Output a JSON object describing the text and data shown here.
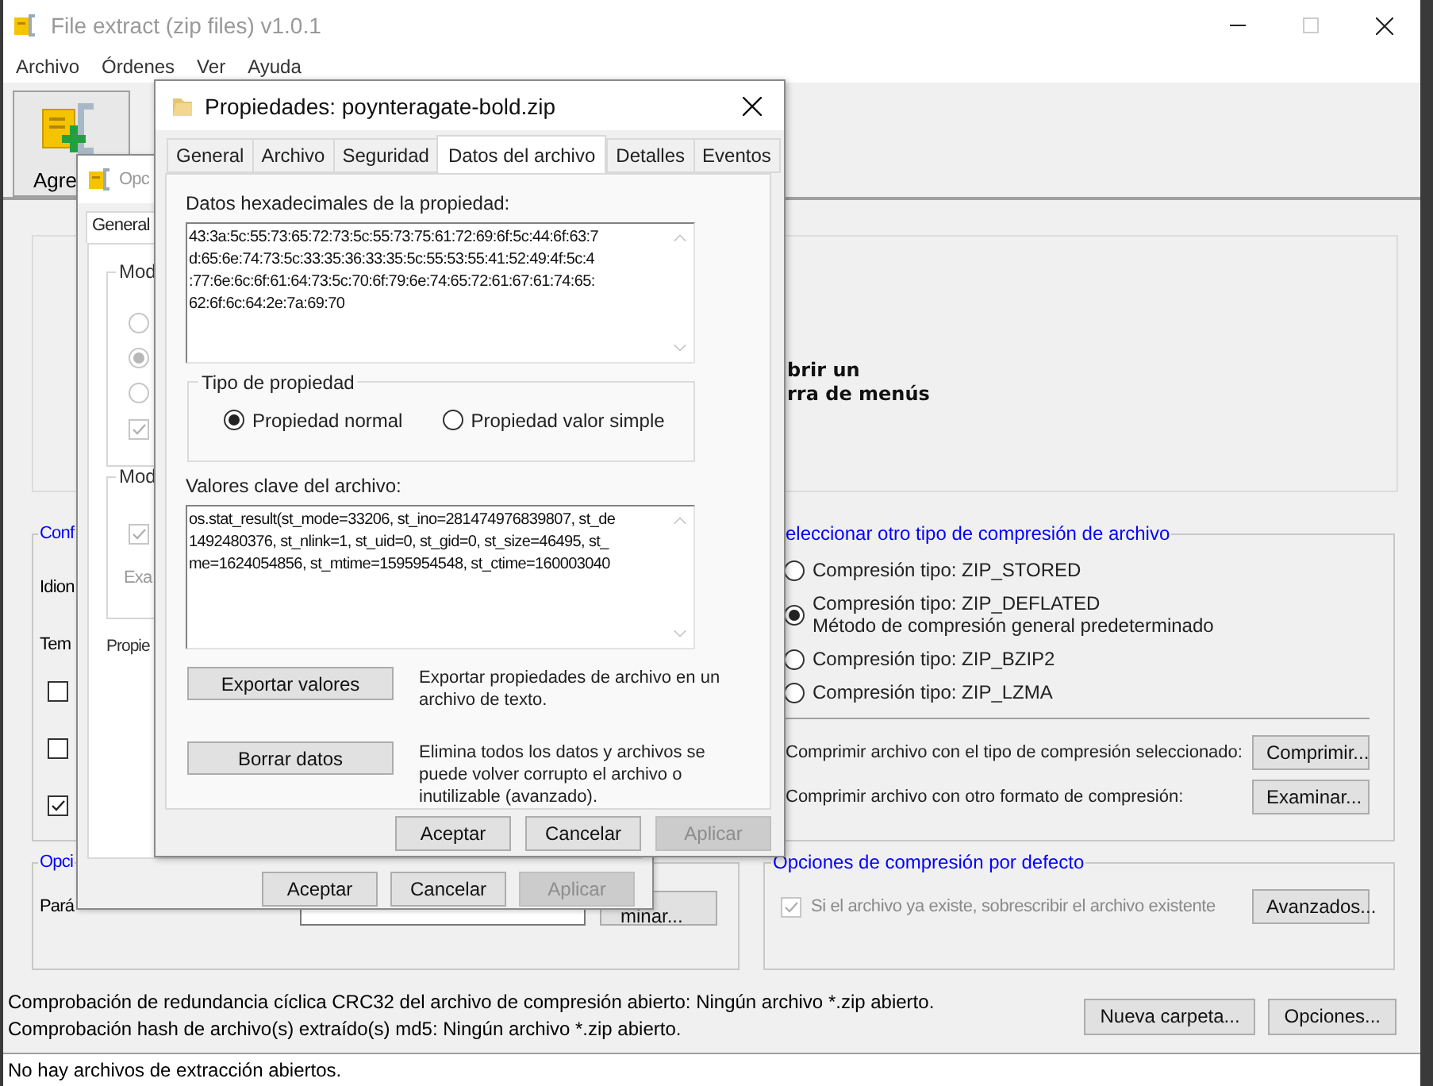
{
  "window": {
    "title": "File extract (zip files) v1.0.1",
    "controls": [
      {
        "kind": "minimize",
        "disabled": false
      },
      {
        "kind": "maximize",
        "disabled": true
      },
      {
        "kind": "close",
        "disabled": false
      }
    ]
  },
  "menu": [
    "Archivo",
    "Órdenes",
    "Ver",
    "Ayuda"
  ],
  "toolbar": [
    {
      "label": "Agre"
    }
  ],
  "top_panel": {
    "lines": [
      "brir un",
      "rra de menús"
    ]
  },
  "config_group": {
    "legend": "Conf",
    "labels": [
      "Idion",
      "Tem"
    ],
    "checkboxes": [
      {
        "checked": false
      },
      {
        "checked": false
      },
      {
        "checked": true
      }
    ]
  },
  "compression_group": {
    "legend": "eleccionar otro tipo de compresión de archivo",
    "options": [
      {
        "label": "Compresión tipo: ZIP_STORED",
        "selected": false
      },
      {
        "label": "Compresión tipo: ZIP_DEFLATED",
        "note": "Método de compresión general predeterminado",
        "selected": true
      },
      {
        "label": "Compresión tipo: ZIP_BZIP2",
        "selected": false
      },
      {
        "label": "Compresión tipo: ZIP_LZMA",
        "selected": false
      }
    ],
    "actions": [
      {
        "text": "Comprimir archivo con el tipo de compresión seleccionado:",
        "button": "Comprimir..."
      },
      {
        "text": "Comprimir archivo con otro formato de compresión:",
        "button": "Examinar..."
      }
    ]
  },
  "options_group": {
    "legend": "Opci",
    "label": "Pará",
    "button": "minar..."
  },
  "defaults_group": {
    "legend": "Opciones de compresión por defecto",
    "checkbox": {
      "label": "Si el archivo ya existe, sobrescribir el archivo existente",
      "checked": true,
      "disabled": true
    },
    "button": "Avanzados..."
  },
  "checksums": [
    "Comprobación de redundancia cíclica CRC32 del archivo de compresión abierto: Ningún archivo *.zip abierto.",
    "Comprobación hash de archivo(s) extraído(s) md5: Ningún archivo *.zip abierto."
  ],
  "bottom_buttons": [
    "Nueva carpeta...",
    "Opciones..."
  ],
  "status_bar": "No hay archivos de extracción abiertos.",
  "options_dialog": {
    "title": "Opc",
    "tabs": [
      {
        "label": "General",
        "selected": true
      }
    ],
    "group1": {
      "legend": "Mod",
      "radios": [
        {
          "selected": false,
          "disabled": true
        },
        {
          "selected": true,
          "disabled": true
        },
        {
          "selected": false,
          "disabled": true
        }
      ],
      "checkbox": {
        "checked": true,
        "disabled": true
      }
    },
    "group2": {
      "legend": "Mod",
      "checkbox": {
        "checked": true,
        "disabled": true
      },
      "label": "Exa"
    },
    "label": "Propie",
    "buttons": [
      {
        "label": "Aceptar",
        "disabled": false
      },
      {
        "label": "Cancelar",
        "disabled": false
      },
      {
        "label": "Aplicar",
        "disabled": true
      }
    ]
  },
  "properties_dialog": {
    "title": "Propiedades: poynteragate-bold.zip",
    "tabs": [
      {
        "label": "General",
        "selected": false
      },
      {
        "label": "Archivo",
        "selected": false
      },
      {
        "label": "Seguridad",
        "selected": false
      },
      {
        "label": "Datos del archivo",
        "selected": true
      },
      {
        "label": "Detalles",
        "selected": false
      },
      {
        "label": "Eventos",
        "selected": false
      }
    ],
    "hex_label": "Datos hexadecimales de la propiedad:",
    "hex_lines": [
      "43:3a:5c:55:73:65:72:73:5c:55:73:75:61:72:69:6f:5c:44:6f:63:7",
      "d:65:6e:74:73:5c:33:35:36:33:35:5c:55:53:55:41:52:49:4f:5c:4",
      ":77:6e:6c:6f:61:64:73:5c:70:6f:79:6e:74:65:72:61:67:61:74:65:",
      "62:6f:6c:64:2e:7a:69:70"
    ],
    "type_group": {
      "legend": "Tipo de propiedad",
      "options": [
        {
          "label": "Propiedad normal",
          "selected": true
        },
        {
          "label": "Propiedad valor simple",
          "selected": false
        }
      ]
    },
    "values_label": "Valores clave del archivo:",
    "value_lines": [
      "os.stat_result(st_mode=33206, st_ino=281474976839807, st_de",
      "1492480376, st_nlink=1, st_uid=0, st_gid=0, st_size=46495, st_",
      "me=1624054856, st_mtime=1595954548, st_ctime=160003040"
    ],
    "actions": [
      {
        "button": "Exportar valores",
        "description": "Exportar propiedades de archivo en un archivo de texto."
      },
      {
        "button": "Borrar datos",
        "description": "Elimina todos los datos y archivos se puede volver corrupto el archivo o inutilizable (avanzado)."
      }
    ],
    "buttons": [
      {
        "label": "Aceptar",
        "disabled": false
      },
      {
        "label": "Cancelar",
        "disabled": false
      },
      {
        "label": "Aplicar",
        "disabled": true
      }
    ]
  }
}
